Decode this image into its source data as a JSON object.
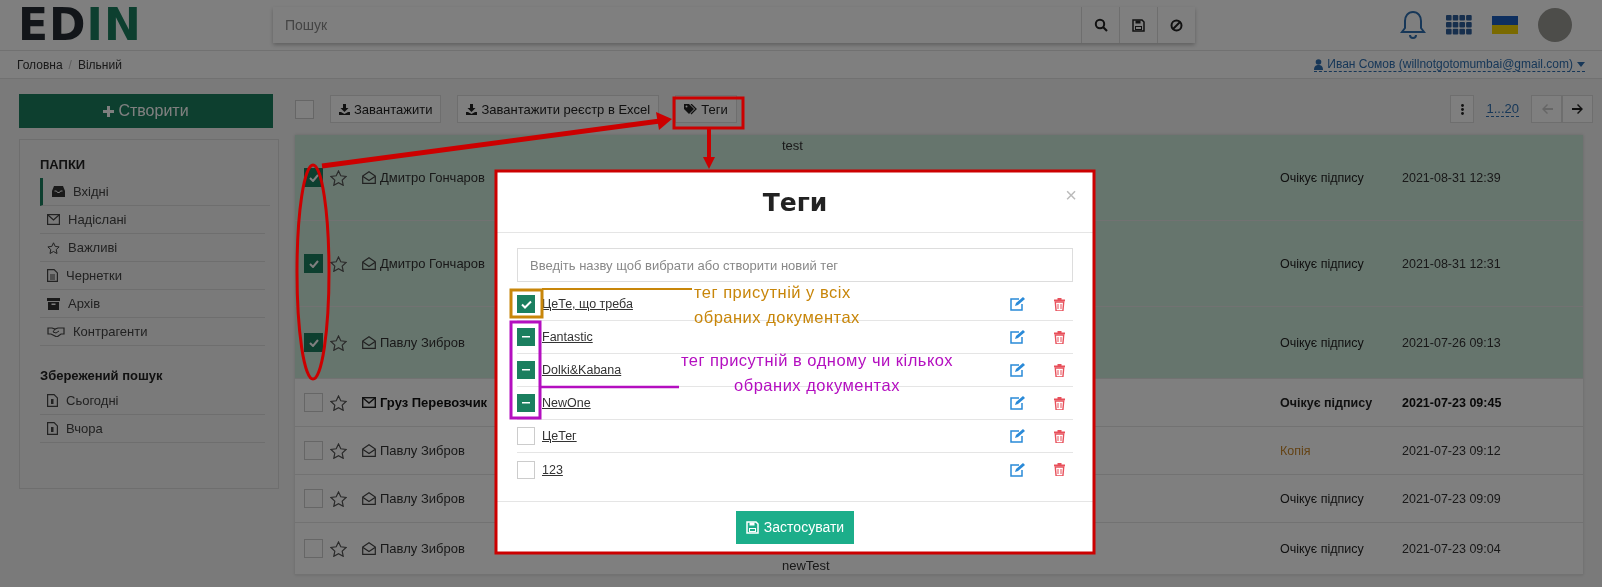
{
  "header": {
    "logo": {
      "text": "ED",
      "accent_text": "IN"
    },
    "search": {
      "placeholder": "Пошук"
    }
  },
  "breadcrumbs": {
    "items": [
      "Головна",
      "Вільний"
    ],
    "separator": "/"
  },
  "user": {
    "name": "Иван Сомов (willnotgotomumbai@gmail.com)"
  },
  "sidebar": {
    "create_button": "Створити",
    "folders_title": "ПАПКИ",
    "folders": [
      {
        "label": "Вхідні",
        "selected": true
      },
      {
        "label": "Надіслані",
        "selected": false
      },
      {
        "label": "Важливі",
        "selected": false
      },
      {
        "label": "Чернетки",
        "selected": false
      },
      {
        "label": "Архів",
        "selected": false
      },
      {
        "label": "Контрагенти",
        "selected": false
      }
    ],
    "saved_title": "Збережений пошук",
    "saved": [
      {
        "label": "Сьогодні"
      },
      {
        "label": "Вчора"
      }
    ]
  },
  "toolbar": {
    "select_all": {
      "checked": false
    },
    "buttons": [
      {
        "label": "Завантажити"
      },
      {
        "label": "Завантажити реєстр в Excel"
      },
      {
        "label": "Теги"
      }
    ],
    "pagination": "1...20",
    "prev_disabled": true
  },
  "rows": [
    {
      "checked": true,
      "starred": false,
      "unread": false,
      "sender": "Дмитро Гончаров",
      "subject": "test",
      "status": "Очікує підпису",
      "kind": "normal",
      "date": "2021-08-31 12:39"
    },
    {
      "checked": true,
      "starred": false,
      "unread": false,
      "sender": "Дмитро Гончаров",
      "status": "Очікує підпису",
      "kind": "normal",
      "date": "2021-08-31 12:31"
    },
    {
      "checked": true,
      "starred": false,
      "unread": false,
      "sender": "Павлу Зибров",
      "status": "Очікує підпису",
      "kind": "normal",
      "date": "2021-07-26 09:13"
    },
    {
      "checked": false,
      "starred": false,
      "unread": true,
      "sender": "Груз Перевозчик",
      "status": "Очікує підпису",
      "kind": "normal",
      "date": "2021-07-23 09:45"
    },
    {
      "checked": false,
      "starred": false,
      "unread": false,
      "sender": "Павлу Зибров",
      "status": "Копія",
      "kind": "copy",
      "date": "2021-07-23 09:12"
    },
    {
      "checked": false,
      "starred": false,
      "unread": false,
      "sender": "Павлу Зибров",
      "status": "Очікує підпису",
      "kind": "normal",
      "date": "2021-07-23 09:09"
    },
    {
      "checked": false,
      "starred": false,
      "unread": false,
      "sender": "Павлу Зибров",
      "subject": "newTest",
      "status": "Очікує підпису",
      "kind": "normal",
      "date": "2021-07-23 09:04"
    }
  ],
  "modal": {
    "title": "Теги",
    "close": "×",
    "input": {
      "placeholder": "Введіть назву щоб вибрати або створити новий тег"
    },
    "tags": [
      {
        "name": "ЦеТе, що треба",
        "kind": "all"
      },
      {
        "name": "Fantastic",
        "kind": "some"
      },
      {
        "name": "Dolki&Kabana",
        "kind": "some"
      },
      {
        "name": "NewOne",
        "kind": "some"
      },
      {
        "name": "ЦеТег",
        "kind": "none"
      },
      {
        "name": "123",
        "kind": "none"
      }
    ],
    "apply_button": "Застосувати"
  },
  "annotations": [
    {
      "text": "тег присутній у всіх обраних документах",
      "color": "#c8860a",
      "kind": "all"
    },
    {
      "text": "тег присутній в одному чи кількох обраних документах",
      "color": "#b40fc0",
      "kind": "some"
    }
  ]
}
